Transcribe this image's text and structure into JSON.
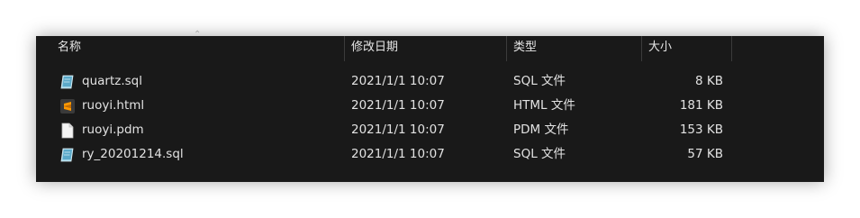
{
  "columns": {
    "name": "名称",
    "modified": "修改日期",
    "type": "类型",
    "size": "大小"
  },
  "files": [
    {
      "name": "quartz.sql",
      "modified": "2021/1/1 10:07",
      "type": "SQL 文件",
      "size": "8 KB",
      "icon": "sql-file-icon"
    },
    {
      "name": "ruoyi.html",
      "modified": "2021/1/1 10:07",
      "type": "HTML 文件",
      "size": "181 KB",
      "icon": "sublime-html-file-icon"
    },
    {
      "name": "ruoyi.pdm",
      "modified": "2021/1/1 10:07",
      "type": "PDM 文件",
      "size": "153 KB",
      "icon": "blank-file-icon"
    },
    {
      "name": "ry_20201214.sql",
      "modified": "2021/1/1 10:07",
      "type": "SQL 文件",
      "size": "57 KB",
      "icon": "sql-file-icon"
    }
  ],
  "colors": {
    "background": "#191919",
    "text": "#e2e2e2",
    "separator": "#3b3b3b"
  }
}
